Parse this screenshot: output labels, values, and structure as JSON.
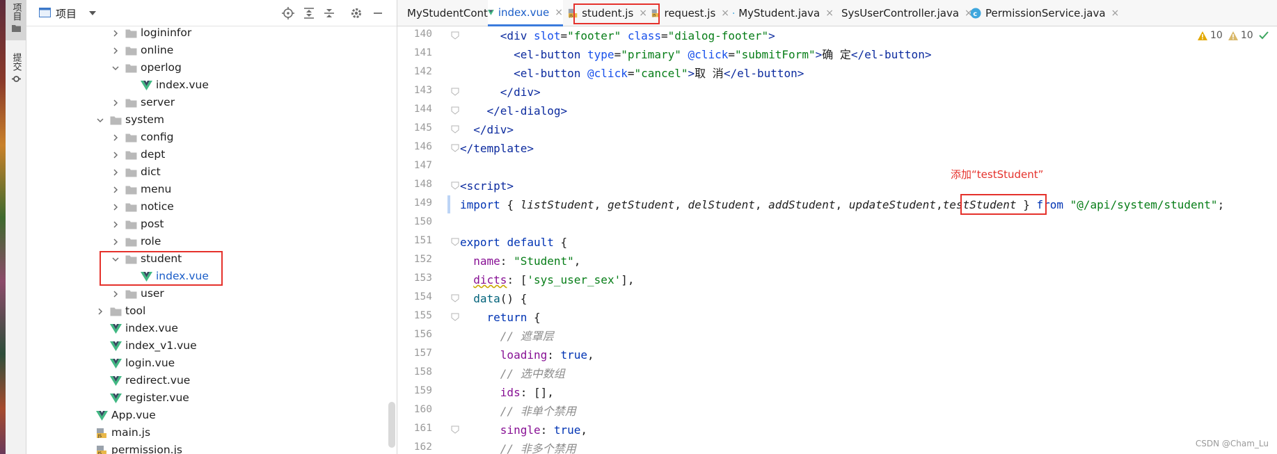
{
  "tool_strip": {
    "project_label": "项目",
    "commit_label": "提交"
  },
  "project_panel": {
    "title": "项目",
    "tree": [
      {
        "label": "logininfor",
        "type": "folder",
        "state": "collapsed",
        "depth": 3
      },
      {
        "label": "online",
        "type": "folder",
        "state": "collapsed",
        "depth": 3
      },
      {
        "label": "operlog",
        "type": "folder",
        "state": "expanded",
        "depth": 3
      },
      {
        "label": "index.vue",
        "type": "vue",
        "depth": 4
      },
      {
        "label": "server",
        "type": "folder",
        "state": "collapsed",
        "depth": 3
      },
      {
        "label": "system",
        "type": "folder",
        "state": "expanded",
        "depth": 2
      },
      {
        "label": "config",
        "type": "folder",
        "state": "collapsed",
        "depth": 3
      },
      {
        "label": "dept",
        "type": "folder",
        "state": "collapsed",
        "depth": 3
      },
      {
        "label": "dict",
        "type": "folder",
        "state": "collapsed",
        "depth": 3
      },
      {
        "label": "menu",
        "type": "folder",
        "state": "collapsed",
        "depth": 3
      },
      {
        "label": "notice",
        "type": "folder",
        "state": "collapsed",
        "depth": 3
      },
      {
        "label": "post",
        "type": "folder",
        "state": "collapsed",
        "depth": 3
      },
      {
        "label": "role",
        "type": "folder",
        "state": "collapsed",
        "depth": 3
      },
      {
        "label": "student",
        "type": "folder",
        "state": "expanded",
        "depth": 3
      },
      {
        "label": "index.vue",
        "type": "vue",
        "depth": 4,
        "selected": true
      },
      {
        "label": "user",
        "type": "folder",
        "state": "collapsed",
        "depth": 3
      },
      {
        "label": "tool",
        "type": "folder",
        "state": "collapsed",
        "depth": 2
      },
      {
        "label": "index.vue",
        "type": "vue",
        "depth": 2
      },
      {
        "label": "index_v1.vue",
        "type": "vue",
        "depth": 2
      },
      {
        "label": "login.vue",
        "type": "vue",
        "depth": 2
      },
      {
        "label": "redirect.vue",
        "type": "vue",
        "depth": 2
      },
      {
        "label": "register.vue",
        "type": "vue",
        "depth": 2
      },
      {
        "label": "App.vue",
        "type": "vue",
        "depth": 1
      },
      {
        "label": "main.js",
        "type": "js",
        "depth": 1
      },
      {
        "label": "permission.js",
        "type": "js",
        "depth": 1
      }
    ]
  },
  "tabs": [
    {
      "label": "MyStudentController.java",
      "type": "class",
      "active": false
    },
    {
      "label": "index.vue",
      "type": "vue",
      "active": true
    },
    {
      "label": "student.js",
      "type": "js",
      "active": false
    },
    {
      "label": "request.js",
      "type": "js",
      "active": false
    },
    {
      "label": "MyStudent.java",
      "type": "class",
      "active": false
    },
    {
      "label": "SysUserController.java",
      "type": "class",
      "active": false
    },
    {
      "label": "PermissionService.java",
      "type": "class",
      "active": false
    }
  ],
  "tab_close_glyph": "×",
  "editor": {
    "line_numbers": [
      "140",
      "141",
      "142",
      "143",
      "144",
      "145",
      "146",
      "147",
      "148",
      "149",
      "150",
      "151",
      "152",
      "153",
      "154",
      "155",
      "156",
      "157",
      "158",
      "159",
      "160",
      "161",
      "162"
    ],
    "warnings": [
      {
        "count": "10",
        "color": "#e3a900"
      },
      {
        "count": "10",
        "color": "#e3a900"
      }
    ],
    "lines": {
      "l140": {
        "indent": "      ",
        "t1": "<div ",
        "a1": "slot",
        "e1": "=",
        "s1": "\"footer\"",
        "sp": " ",
        "a2": "class",
        "e2": "=",
        "s2": "\"dialog-footer\"",
        "t2": ">"
      },
      "l141": {
        "indent": "        ",
        "t1": "<el-button ",
        "a1": "type",
        "e1": "=",
        "s1": "\"primary\"",
        "sp": " ",
        "a2": "@click",
        "e2": "=",
        "s2": "\"submitForm\"",
        "t2": ">",
        "text": "确 定",
        "t3": "</el-button>"
      },
      "l142": {
        "indent": "        ",
        "t1": "<el-button ",
        "a1": "@click",
        "e1": "=",
        "s1": "\"cancel\"",
        "t2": ">",
        "text": "取 消",
        "t3": "</el-button>"
      },
      "l143": {
        "indent": "      ",
        "t1": "</div>"
      },
      "l144": {
        "indent": "    ",
        "t1": "</el-dialog>"
      },
      "l145": {
        "indent": "  ",
        "t1": "</div>"
      },
      "l146": {
        "indent": "",
        "t1": "</template>"
      },
      "l148": {
        "indent": "",
        "t1": "<script>"
      },
      "l149": {
        "kw": "import",
        "p1": " { ",
        "f1": "listStudent",
        "c1": ", ",
        "f2": "getStudent",
        "c2": ", ",
        "f3": "delStudent",
        "c3": ", ",
        "f4": "addStudent",
        "c4": ", ",
        "f5": "updateStudent",
        "c5": ",",
        "f6": "testStudent",
        "p2": " } ",
        "kw2": "from",
        "sp": " ",
        "s1": "\"@/api/system/student\"",
        "semi": ";"
      },
      "l151": {
        "kw": "export",
        "sp": " ",
        "kw2": "default",
        "p1": " {"
      },
      "l152": {
        "indent": "  ",
        "prop": "name",
        "col": ": ",
        "s1": "\"Student\"",
        "com": ","
      },
      "l153": {
        "indent": "  ",
        "prop": "dicts",
        "col": ": [",
        "s1": "'sys_user_sex'",
        "com": "],"
      },
      "l154": {
        "indent": "  ",
        "fn": "data",
        "p1": "() {"
      },
      "l155": {
        "indent": "    ",
        "kw": "return",
        "p1": " {"
      },
      "l156": {
        "indent": "      ",
        "com": "// 遮罩层"
      },
      "l157": {
        "indent": "      ",
        "prop": "loading",
        "col": ": ",
        "kw": "true",
        "com": ","
      },
      "l158": {
        "indent": "      ",
        "com": "// 选中数组"
      },
      "l159": {
        "indent": "      ",
        "prop": "ids",
        "col": ": [],"
      },
      "l160": {
        "indent": "      ",
        "com": "// 非单个禁用"
      },
      "l161": {
        "indent": "      ",
        "prop": "single",
        "col": ": ",
        "kw": "true",
        "com": ","
      },
      "l162": {
        "indent": "      ",
        "com": "// 非多个禁用"
      }
    }
  },
  "annotation": {
    "text": "添加“testStudent”",
    "color": "#e5312b"
  },
  "watermark": "CSDN @Cham_Lu"
}
